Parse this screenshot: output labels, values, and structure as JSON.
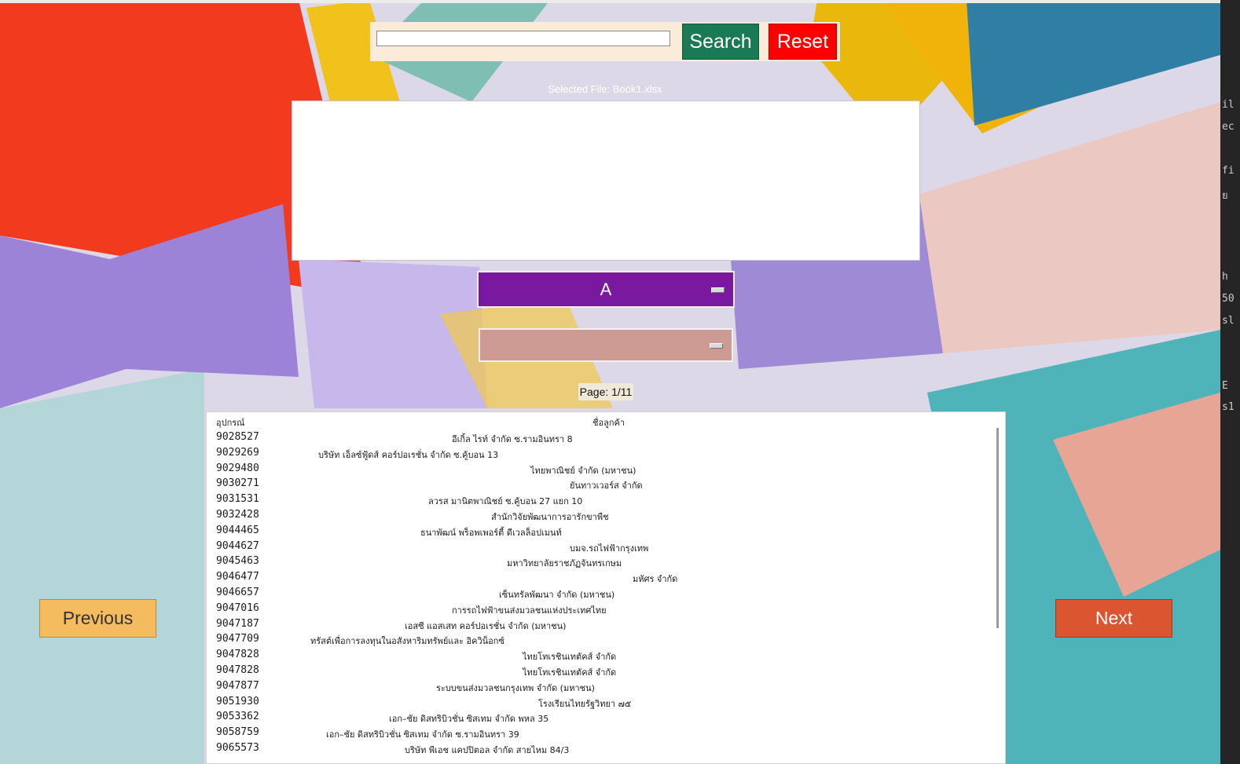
{
  "search": {
    "placeholder": "",
    "value": "",
    "search_label": "Search",
    "reset_label": "Reset"
  },
  "file": {
    "selected_label": "Selected File: Book1.xlsx"
  },
  "filters": {
    "column_value": "A",
    "value_value": ""
  },
  "pagination": {
    "page_label": "Page: 1/11",
    "previous_label": "Previous",
    "next_label": "Next"
  },
  "results": {
    "headers": [
      "อุปกรณ์",
      "ชื่อลูกค้า"
    ],
    "rows": [
      {
        "code": "9028527",
        "name": "อีเกิ้ล ไรท์   จำกัด  ซ.รามอินทรา  8"
      },
      {
        "code": "9029269",
        "name": "บริษัท  เอ็ลซ์ฟู้ดส์  คอร์ปอเรชั่น  จำกัด  ซ.คู้บอน  13"
      },
      {
        "code": "9029480",
        "name": "ไทยพาณิชย์  จำกัด (มหาชน)"
      },
      {
        "code": "9030271",
        "name": "ยันทาวเวอร์ส  จำกัด"
      },
      {
        "code": "9031531",
        "name": "ลวรส  มานิตพาณิชย์  ซ.คู้บอน  27  แยก  10"
      },
      {
        "code": "9032428",
        "name": "สำนักวิจัยพัฒนาการอารักขาพืช"
      },
      {
        "code": "9044465",
        "name": "ธนาพัฒน์  พร็อพเพอร์ตี้  ดีเวลล็อปเมนท์"
      },
      {
        "code": "9044627",
        "name": "บมจ.รถไฟฟ้ากรุงเทพ"
      },
      {
        "code": "9045463",
        "name": "มหาวิทยาลัยราชภัฏจันทรเกษม"
      },
      {
        "code": "9046477",
        "name": "มหัศร  จำกัด"
      },
      {
        "code": "9046657",
        "name": "เซ็นทรัลพัฒนา  จำกัด  (มหาชน)"
      },
      {
        "code": "9047016",
        "name": "การรถไฟฟ้าขนส่งมวลชนแห่งประเทศไทย"
      },
      {
        "code": "9047187",
        "name": "เอสซี  แอสเสท  คอร์ปอเรชั่น  จำกัด  (มหาชน)"
      },
      {
        "code": "9047709",
        "name": "ทรัสต์เพื่อการลงทุนในอสังหาริมทรัพย์และ  อิควิน็อกซ์"
      },
      {
        "code": "9047828",
        "name": "ไทยโทเรชินเทตัคส์    จำกัด"
      },
      {
        "code": "9047828",
        "name": "ไทยโทเรชินเทตัคส์    จำกัด"
      },
      {
        "code": "9047877",
        "name": "ระบบขนส่งมวลชนกรุงเทพ  จำกัด  (มหาชน)"
      },
      {
        "code": "9051930",
        "name": "โรงเรียนไทยรัฐวิทยา  ๗๕"
      },
      {
        "code": "9053362",
        "name": "เอก–ชัย  ดิสทริบิวชั่น  ซิสเทม  จำกัด  พหล  35"
      },
      {
        "code": "9058759",
        "name": "เอก–ชัย  ดิสทริบิวชั่น  ซิสเทม  จำกัด  ซ.รามอินทรา  39"
      },
      {
        "code": "9065573",
        "name": "บริษัท  พีเอช  แคปปิตอล  จำกัด  สายไหม  84/3"
      }
    ]
  },
  "editor_strip": [
    "il",
    "ec",
    "fi",
    "ย",
    "h",
    "50",
    "sl",
    "E",
    "s1"
  ],
  "colors": {
    "search_button": "#1a7a55",
    "reset_button": "#ff0000",
    "column_dropdown": "#7a189f",
    "value_dropdown": "#cd9b94",
    "previous_button": "#f4bc5e",
    "next_button": "#db5530"
  }
}
